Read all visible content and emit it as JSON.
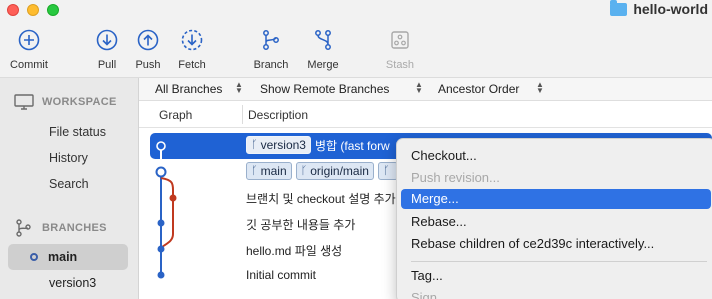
{
  "window": {
    "title": "hello-world",
    "folder_icon": "folder-icon"
  },
  "toolbar": {
    "commit": "Commit",
    "pull": "Pull",
    "push": "Push",
    "fetch": "Fetch",
    "branch": "Branch",
    "merge": "Merge",
    "stash": "Stash"
  },
  "sidebar": {
    "workspace_header": "WORKSPACE",
    "workspace_items": [
      "File status",
      "History",
      "Search"
    ],
    "branches_header": "BRANCHES",
    "branches": [
      "main",
      "version3"
    ]
  },
  "filters": {
    "branches": "All Branches",
    "remote": "Show Remote Branches",
    "order": "Ancestor Order"
  },
  "columns": {
    "graph": "Graph",
    "description": "Description"
  },
  "commits": {
    "row0": {
      "tag": "version3",
      "text": "병합 (fast forw"
    },
    "row1": {
      "tags": [
        "main",
        "origin/main",
        ""
      ]
    },
    "row2": {
      "text": "브랜치 및 checkout 설명 추가"
    },
    "row3": {
      "text": "깃 공부한 내용들 추가"
    },
    "row4": {
      "text": "hello.md 파일 생성"
    },
    "row5": {
      "text": "Initial commit"
    }
  },
  "context_menu": {
    "checkout": "Checkout...",
    "push_revision": "Push revision...",
    "merge": "Merge...",
    "rebase": "Rebase...",
    "rebase_children": "Rebase children of ce2d39c interactively...",
    "tag": "Tag...",
    "sign": "Sign..."
  },
  "colors": {
    "accent": "#1f62d4",
    "graph_blue": "#2a63c6",
    "graph_red": "#c0391f"
  }
}
